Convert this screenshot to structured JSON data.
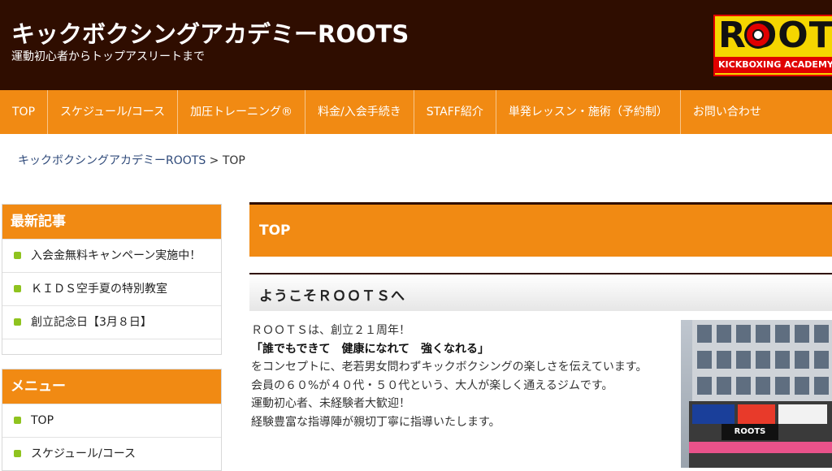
{
  "header": {
    "title": "キックボクシングアカデミーROOTS",
    "tagline": "運動初心者からトップアスリートまで",
    "logo": {
      "main": "ROOTS",
      "sub": "KICKBOXING ACADEMY"
    },
    "background_color": "#2f0d00"
  },
  "nav": {
    "accent_color": "#f18a13",
    "items": [
      {
        "label": "TOP"
      },
      {
        "label": "スケジュール/コース"
      },
      {
        "label": "加圧トレーニング®"
      },
      {
        "label": "料金/入会手続き"
      },
      {
        "label": "STAFF紹介"
      },
      {
        "label": "単発レッスン・施術（予約制）"
      },
      {
        "label": "お問い合わせ"
      }
    ]
  },
  "breadcrumb": {
    "home": "キックボクシングアカデミーROOTS",
    "separator": " > ",
    "current": "TOP"
  },
  "sidebar": {
    "recent": {
      "title": "最新記事",
      "items": [
        {
          "label": "入会金無料キャンペーン実施中！"
        },
        {
          "label": "ＫＩＤＳ空手夏の特別教室"
        },
        {
          "label": "創立記念日【3月８日】"
        }
      ]
    },
    "menu": {
      "title": "メニュー",
      "items": [
        {
          "label": "TOP"
        },
        {
          "label": "スケジュール/コース"
        }
      ]
    },
    "bullet_color": "#8fc31f"
  },
  "main": {
    "page_heading": "TOP",
    "section_heading": "ようこそＲＯＯＴＳへ",
    "intro": {
      "line1": "ＲＯＯＴＳは、創立２１周年！",
      "line2": "「誰でもできて　健康になれて　強くなれる」",
      "line3": "をコンセプトに、老若男女問わずキックボクシングの楽しさを伝えています。",
      "line4": "会員の６０%が４０代・５０代という、大人が楽しく通えるジムです。",
      "line5": "運動初心者、未経験者大歓迎！",
      "line6": "経験豊富な指導陣が親切丁寧に指導いたします。"
    },
    "photo": {
      "sign": "ROOTS"
    }
  }
}
